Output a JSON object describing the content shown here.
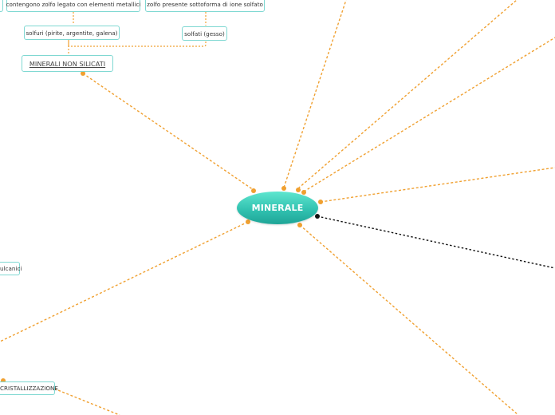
{
  "root": {
    "label": "MINERALE"
  },
  "nodes": {
    "zolfo_metallici": "contengono zolfo legato con elementi metallici",
    "zolfo_ione": "zolfo presente sottoforma di ione solfato",
    "solfuri": "solfuri (pirite, argentite, galena)",
    "solfati": "solfati (gesso)",
    "minerali_non_silicati": "MINERALI NON SILICATI",
    "vulcanici": "ulcanici",
    "cristallizzazione": "CRISTALLIZZAZIONE"
  },
  "colors": {
    "root_fill_top": "#5ee6cf",
    "root_fill_bottom": "#1fa597",
    "node_border": "#7fd8d2",
    "branch_line": "#f0a030",
    "black_line": "#111111",
    "dot": "#f0a030"
  }
}
